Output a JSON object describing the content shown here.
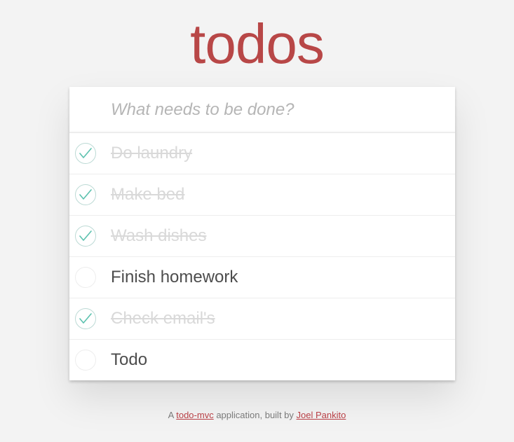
{
  "header": {
    "title": "todos"
  },
  "new_todo": {
    "placeholder": "What needs to be done?",
    "value": ""
  },
  "todos": [
    {
      "label": "Do laundry",
      "completed": true
    },
    {
      "label": "Make bed",
      "completed": true
    },
    {
      "label": "Wash dishes",
      "completed": true
    },
    {
      "label": "Finish homework",
      "completed": false
    },
    {
      "label": "Check email's",
      "completed": true
    },
    {
      "label": "Todo",
      "completed": false
    }
  ],
  "footer": {
    "prefix": "A",
    "link1": "todo-mvc",
    "middle": "application, built by",
    "link2": "Joel Pankito"
  },
  "colors": {
    "title": "#b83f45",
    "check": "#5dc2af",
    "background": "#f3f3f3"
  },
  "icons": {
    "toggle_checked": "checkmark-icon"
  }
}
